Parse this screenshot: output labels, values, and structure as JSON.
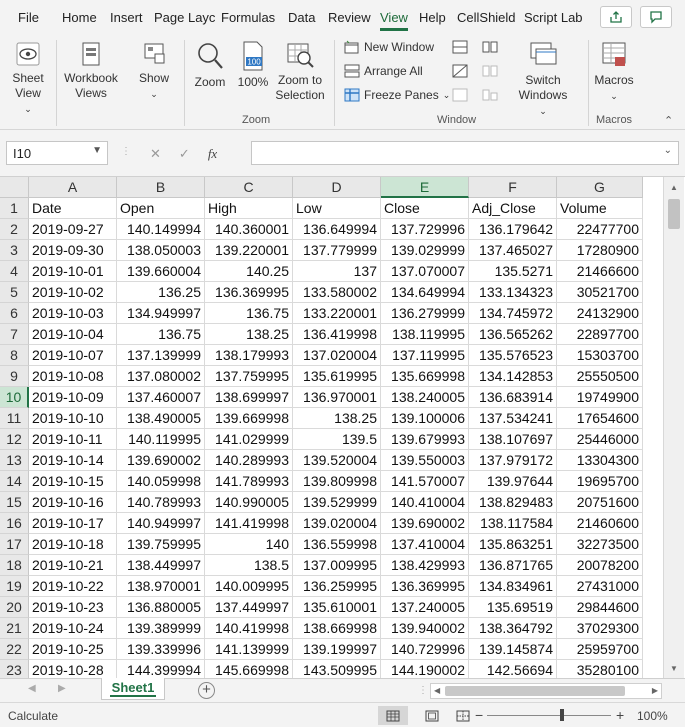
{
  "menu": {
    "items": [
      "File",
      "Home",
      "Insert",
      "Page Layc",
      "Formulas",
      "Data",
      "Review",
      "View",
      "Help",
      "CellShield",
      "Script Lab"
    ],
    "active": "View"
  },
  "ribbon": {
    "sheet_view": "Sheet View",
    "workbook_views": "Workbook Views",
    "show": "Show",
    "zoom": "Zoom",
    "zoom100": "100%",
    "zoom100_icon_text": "100",
    "zoom_to_selection": "Zoom to Selection",
    "new_window": "New Window",
    "arrange_all": "Arrange All",
    "freeze_panes": "Freeze Panes",
    "switch_windows": "Switch Windows",
    "macros": "Macros",
    "group_zoom": "Zoom",
    "group_window": "Window",
    "group_macros": "Macros"
  },
  "formula_bar": {
    "name_box": "I10",
    "fx": "fx",
    "formula": ""
  },
  "grid": {
    "columns": [
      "A",
      "B",
      "C",
      "D",
      "E",
      "F",
      "G"
    ],
    "selected_column": "E",
    "selected_row": "10",
    "rows": [
      {
        "n": "1",
        "cells": [
          "Date",
          "Open",
          "High",
          "Low",
          "Close",
          "Adj_Close",
          "Volume"
        ]
      },
      {
        "n": "2",
        "cells": [
          "2019-09-27",
          "140.149994",
          "140.360001",
          "136.649994",
          "137.729996",
          "136.179642",
          "22477700"
        ]
      },
      {
        "n": "3",
        "cells": [
          "2019-09-30",
          "138.050003",
          "139.220001",
          "137.779999",
          "139.029999",
          "137.465027",
          "17280900"
        ]
      },
      {
        "n": "4",
        "cells": [
          "2019-10-01",
          "139.660004",
          "140.25",
          "137",
          "137.070007",
          "135.5271",
          "21466600"
        ]
      },
      {
        "n": "5",
        "cells": [
          "2019-10-02",
          "136.25",
          "136.369995",
          "133.580002",
          "134.649994",
          "133.134323",
          "30521700"
        ]
      },
      {
        "n": "6",
        "cells": [
          "2019-10-03",
          "134.949997",
          "136.75",
          "133.220001",
          "136.279999",
          "134.745972",
          "24132900"
        ]
      },
      {
        "n": "7",
        "cells": [
          "2019-10-04",
          "136.75",
          "138.25",
          "136.419998",
          "138.119995",
          "136.565262",
          "22897700"
        ]
      },
      {
        "n": "8",
        "cells": [
          "2019-10-07",
          "137.139999",
          "138.179993",
          "137.020004",
          "137.119995",
          "135.576523",
          "15303700"
        ]
      },
      {
        "n": "9",
        "cells": [
          "2019-10-08",
          "137.080002",
          "137.759995",
          "135.619995",
          "135.669998",
          "134.142853",
          "25550500"
        ]
      },
      {
        "n": "10",
        "cells": [
          "2019-10-09",
          "137.460007",
          "138.699997",
          "136.970001",
          "138.240005",
          "136.683914",
          "19749900"
        ]
      },
      {
        "n": "11",
        "cells": [
          "2019-10-10",
          "138.490005",
          "139.669998",
          "138.25",
          "139.100006",
          "137.534241",
          "17654600"
        ]
      },
      {
        "n": "12",
        "cells": [
          "2019-10-11",
          "140.119995",
          "141.029999",
          "139.5",
          "139.679993",
          "138.107697",
          "25446000"
        ]
      },
      {
        "n": "13",
        "cells": [
          "2019-10-14",
          "139.690002",
          "140.289993",
          "139.520004",
          "139.550003",
          "137.979172",
          "13304300"
        ]
      },
      {
        "n": "14",
        "cells": [
          "2019-10-15",
          "140.059998",
          "141.789993",
          "139.809998",
          "141.570007",
          "139.97644",
          "19695700"
        ]
      },
      {
        "n": "15",
        "cells": [
          "2019-10-16",
          "140.789993",
          "140.990005",
          "139.529999",
          "140.410004",
          "138.829483",
          "20751600"
        ]
      },
      {
        "n": "16",
        "cells": [
          "2019-10-17",
          "140.949997",
          "141.419998",
          "139.020004",
          "139.690002",
          "138.117584",
          "21460600"
        ]
      },
      {
        "n": "17",
        "cells": [
          "2019-10-18",
          "139.759995",
          "140",
          "136.559998",
          "137.410004",
          "135.863251",
          "32273500"
        ]
      },
      {
        "n": "18",
        "cells": [
          "2019-10-21",
          "138.449997",
          "138.5",
          "137.009995",
          "138.429993",
          "136.871765",
          "20078200"
        ]
      },
      {
        "n": "19",
        "cells": [
          "2019-10-22",
          "138.970001",
          "140.009995",
          "136.259995",
          "136.369995",
          "134.834961",
          "27431000"
        ]
      },
      {
        "n": "20",
        "cells": [
          "2019-10-23",
          "136.880005",
          "137.449997",
          "135.610001",
          "137.240005",
          "135.69519",
          "29844600"
        ]
      },
      {
        "n": "21",
        "cells": [
          "2019-10-24",
          "139.389999",
          "140.419998",
          "138.669998",
          "139.940002",
          "138.364792",
          "37029300"
        ]
      },
      {
        "n": "22",
        "cells": [
          "2019-10-25",
          "139.339996",
          "141.139999",
          "139.199997",
          "140.729996",
          "139.145874",
          "25959700"
        ]
      },
      {
        "n": "23",
        "cells": [
          "2019-10-28",
          "144.399994",
          "145.669998",
          "143.509995",
          "144.190002",
          "142.56694",
          "35280100"
        ]
      }
    ]
  },
  "sheets": {
    "tabs": [
      "Sheet1"
    ],
    "active": "Sheet1"
  },
  "status": {
    "mode": "Calculate",
    "zoom": "100%"
  }
}
